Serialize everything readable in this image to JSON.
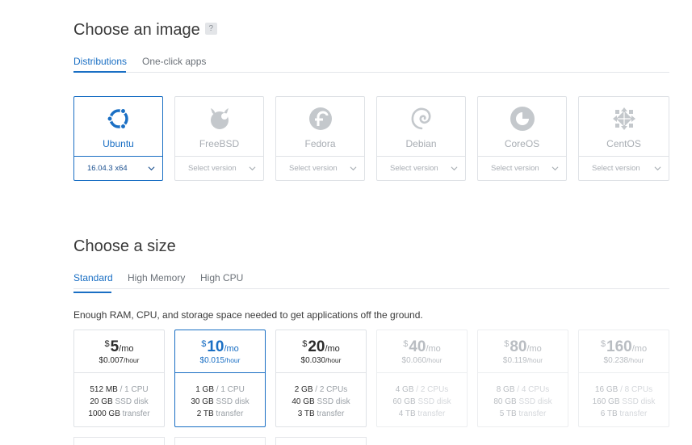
{
  "image_section": {
    "title": "Choose an image",
    "help": "?",
    "tabs": [
      {
        "label": "Distributions",
        "active": true
      },
      {
        "label": "One-click apps",
        "active": false
      }
    ],
    "distros": [
      {
        "name": "Ubuntu",
        "version": "16.04.3 x64",
        "selected": true,
        "icon": "ubuntu-logo-icon"
      },
      {
        "name": "FreeBSD",
        "version": "Select version",
        "selected": false,
        "icon": "freebsd-logo-icon"
      },
      {
        "name": "Fedora",
        "version": "Select version",
        "selected": false,
        "icon": "fedora-logo-icon"
      },
      {
        "name": "Debian",
        "version": "Select version",
        "selected": false,
        "icon": "debian-logo-icon"
      },
      {
        "name": "CoreOS",
        "version": "Select version",
        "selected": false,
        "icon": "coreos-logo-icon"
      },
      {
        "name": "CentOS",
        "version": "Select version",
        "selected": false,
        "icon": "centos-logo-icon"
      }
    ]
  },
  "size_section": {
    "title": "Choose a size",
    "tabs": [
      {
        "label": "Standard",
        "active": true
      },
      {
        "label": "High Memory",
        "active": false
      },
      {
        "label": "High CPU",
        "active": false
      }
    ],
    "description": "Enough RAM, CPU, and storage space needed to get applications off the ground.",
    "plans": [
      {
        "currency": "$",
        "price": "5",
        "per": "/mo",
        "hourly": "$0.007",
        "hourly_unit": "/hour",
        "ram": "512 MB",
        "cpu": "/ 1 CPU",
        "disk": "20 GB",
        "disk_label": "SSD disk",
        "transfer": "1000 GB",
        "transfer_label": "transfer",
        "state": "normal"
      },
      {
        "currency": "$",
        "price": "10",
        "per": "/mo",
        "hourly": "$0.015",
        "hourly_unit": "/hour",
        "ram": "1 GB",
        "cpu": "/ 1 CPU",
        "disk": "30 GB",
        "disk_label": "SSD disk",
        "transfer": "2 TB",
        "transfer_label": "transfer",
        "state": "selected"
      },
      {
        "currency": "$",
        "price": "20",
        "per": "/mo",
        "hourly": "$0.030",
        "hourly_unit": "/hour",
        "ram": "2 GB",
        "cpu": "/ 2 CPUs",
        "disk": "40 GB",
        "disk_label": "SSD disk",
        "transfer": "3 TB",
        "transfer_label": "transfer",
        "state": "normal"
      },
      {
        "currency": "$",
        "price": "40",
        "per": "/mo",
        "hourly": "$0.060",
        "hourly_unit": "/hour",
        "ram": "4 GB",
        "cpu": "/ 2 CPUs",
        "disk": "60 GB",
        "disk_label": "SSD disk",
        "transfer": "4 TB",
        "transfer_label": "transfer",
        "state": "disabled"
      },
      {
        "currency": "$",
        "price": "80",
        "per": "/mo",
        "hourly": "$0.119",
        "hourly_unit": "/hour",
        "ram": "8 GB",
        "cpu": "/ 4 CPUs",
        "disk": "80 GB",
        "disk_label": "SSD disk",
        "transfer": "5 TB",
        "transfer_label": "transfer",
        "state": "disabled"
      },
      {
        "currency": "$",
        "price": "160",
        "per": "/mo",
        "hourly": "$0.238",
        "hourly_unit": "/hour",
        "ram": "16 GB",
        "cpu": "/ 8 CPUs",
        "disk": "160 GB",
        "disk_label": "SSD disk",
        "transfer": "6 TB",
        "transfer_label": "transfer",
        "state": "disabled"
      }
    ]
  },
  "colors": {
    "accent": "#1a6fc4",
    "border": "#dfe2e6",
    "muted_text": "#a8adb3"
  }
}
